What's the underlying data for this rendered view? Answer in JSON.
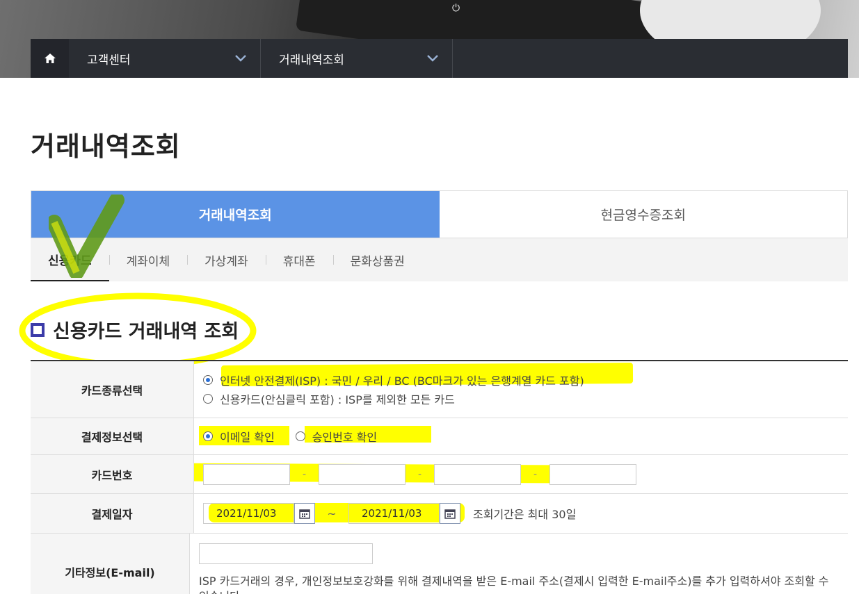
{
  "nav": {
    "home_icon": "home-icon",
    "dropdown1": "고객센터",
    "dropdown2": "거래내역조회"
  },
  "page": {
    "title": "거래내역조회"
  },
  "main_tabs": [
    {
      "label": "거래내역조회",
      "active": true
    },
    {
      "label": "현금영수증조회",
      "active": false
    }
  ],
  "sub_tabs": [
    {
      "label": "신용카드",
      "active": true
    },
    {
      "label": "계좌이체",
      "active": false
    },
    {
      "label": "가상계좌",
      "active": false
    },
    {
      "label": "휴대폰",
      "active": false
    },
    {
      "label": "문화상품권",
      "active": false
    }
  ],
  "section": {
    "title": "신용카드 거래내역 조회"
  },
  "form": {
    "card_type": {
      "label": "카드종류선택",
      "option1": "인터넷 안전결제(ISP) : 국민 / 우리 / BC (BC마크가 있는 은행계열 카드 포함)",
      "option2": "신용카드(안심클릭 포함) : ISP를 제외한 모든 카드",
      "selected": 1
    },
    "payment_info": {
      "label": "결제정보선택",
      "option1": "이메일 확인",
      "option2": "승인번호 확인",
      "selected": 1
    },
    "card_number": {
      "label": "카드번호",
      "separator": "-"
    },
    "payment_date": {
      "label": "결제일자",
      "from": "2021/11/03",
      "to": "2021/11/03",
      "tilde": "~",
      "note": "조회기간은 최대 30일"
    },
    "extra_info": {
      "label": "기타정보(E-mail)",
      "help": "ISP 카드거래의 경우, 개인정보보호강화를 위해 결제내역을 받은 E-mail 주소(결제시 입력한 E-mail주소)를 추가 입력하셔야 조회할 수 있습니다."
    }
  },
  "colors": {
    "nav_bg": "#2a2d33",
    "tab_active": "#5b93e5",
    "highlight": "#ffff00",
    "checkmark": "#5f9a1a"
  }
}
